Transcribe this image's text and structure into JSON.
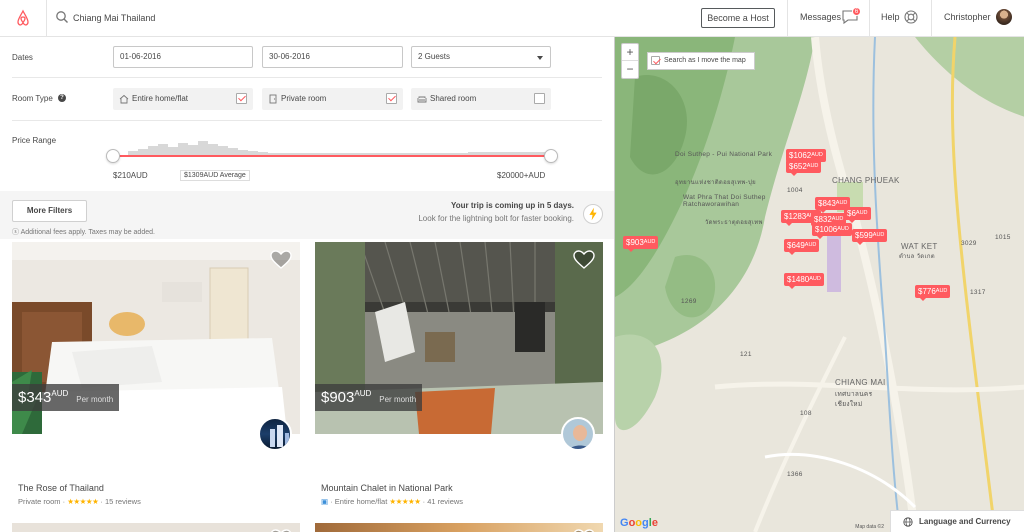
{
  "header": {
    "search_value": "Chiang Mai Thailand",
    "become_host": "Become a Host",
    "messages": "Messages",
    "messages_count": "6",
    "help": "Help",
    "user": "Christopher"
  },
  "filters": {
    "dates_label": "Dates",
    "checkin": "01-06-2016",
    "checkout": "30-06-2016",
    "guests": "2 Guests",
    "room_type_label": "Room Type",
    "room_types": [
      {
        "label": "Entire home/flat",
        "checked": true
      },
      {
        "label": "Private room",
        "checked": true
      },
      {
        "label": "Shared room",
        "checked": false
      }
    ],
    "price_range_label": "Price Range",
    "price_min": "$210AUD",
    "price_avg": "$1309AUD Average",
    "price_max": "$20000+AUD"
  },
  "notice": {
    "more_filters": "More Filters",
    "fees": "Additional fees apply. Taxes may be added.",
    "trip_title": "Your trip is coming up in 5 days.",
    "trip_sub": "Look for the lightning bolt for faster booking."
  },
  "listings": [
    {
      "price": "$343",
      "currency": "AUD",
      "per": "Per month",
      "title": "The Rose of Thailand",
      "type": "Private room",
      "stars": "★★★★★",
      "reviews": "15 reviews"
    },
    {
      "price": "$903",
      "currency": "AUD",
      "per": "Per month",
      "title": "Mountain Chalet in National Park",
      "type": "Entire home/flat",
      "stars": "★★★★★",
      "reviews": "41 reviews"
    }
  ],
  "map": {
    "search_as_move": "Search as I move the map",
    "zoom_in": "+",
    "zoom_out": "−",
    "pins": [
      {
        "price": "$1062",
        "cur": "AUD"
      },
      {
        "price": "$652",
        "cur": "AUD"
      },
      {
        "price": "$843",
        "cur": "AUD"
      },
      {
        "price": "$1283",
        "cur": "AUD"
      },
      {
        "price": "$832",
        "cur": "AUD"
      },
      {
        "price": "$1006",
        "cur": "AUD"
      },
      {
        "price": "$599",
        "cur": "AUD"
      },
      {
        "price": "$649",
        "cur": "AUD"
      },
      {
        "price": "$903",
        "cur": "AUD"
      },
      {
        "price": "$1480",
        "cur": "AUD"
      },
      {
        "price": "$776",
        "cur": "AUD"
      },
      {
        "price": "$6",
        "cur": "AUD"
      }
    ],
    "labels": {
      "doi_suthep": "Doi Suthep - Pui National Park",
      "doi_suthep_thai": "อุทยานแห่งชาติดอยสุเทพ-ปุย",
      "wat_phra": "Wat Phra That Doi Suthep Ratchaworawihan",
      "wat_phra_thai": "วัดพระธาตุดอยสุเทพ",
      "chang_phueak": "CHANG PHUEAK",
      "wat_ket": "WAT KET",
      "wat_ket_thai": "ตำบล วัดเกต",
      "chiang_mai": "CHIANG MAI",
      "chiang_mai_thai": "เทศบาลนคร เชียงใหม่",
      "road_1004": "1004",
      "road_1269": "1269",
      "road_3029": "3029",
      "road_1317": "1317",
      "road_108": "108",
      "road_121": "121",
      "road_1015": "1015",
      "road_1366": "1366"
    },
    "google": "Google",
    "map_data": "Map data ©2",
    "language_currency": "Language and Currency"
  }
}
